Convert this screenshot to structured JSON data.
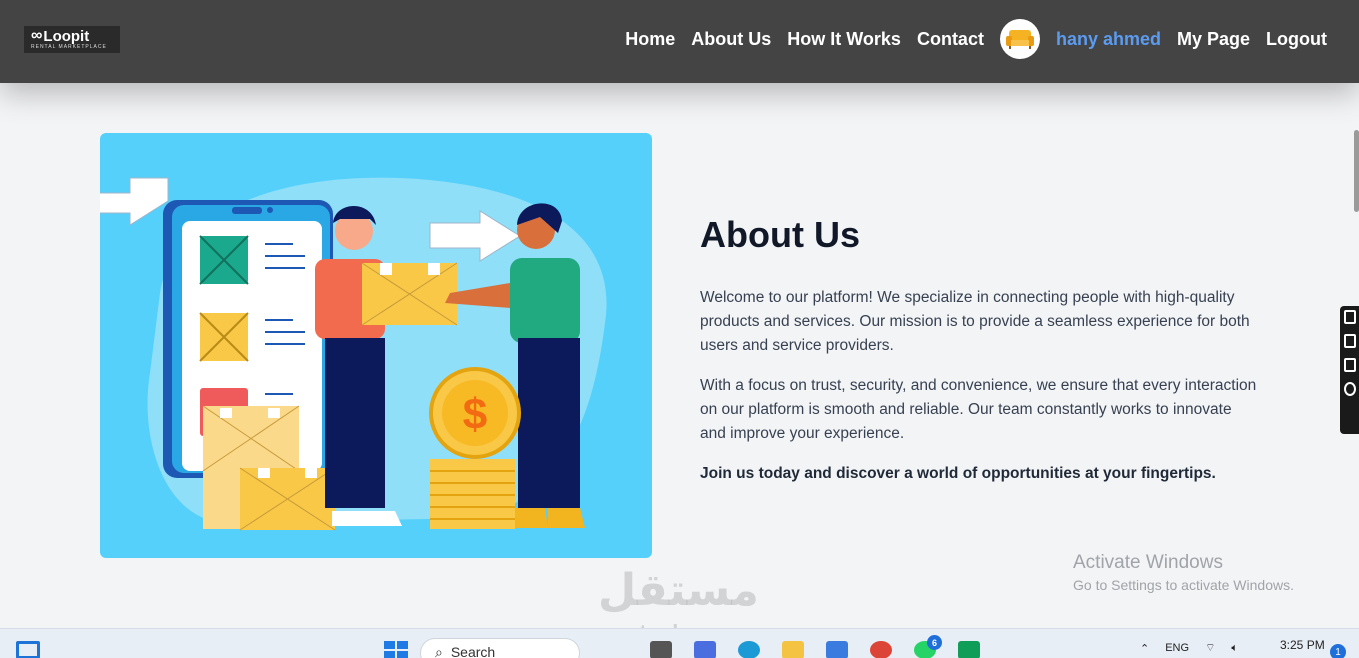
{
  "logo": {
    "name": "Loopit",
    "tagline": "RENTAL MARKETPLACE"
  },
  "nav": {
    "items": [
      "Home",
      "About Us",
      "How It Works",
      "Contact"
    ],
    "user_name": "hany ahmed",
    "my_page": "My Page",
    "logout": "Logout"
  },
  "about": {
    "title": "About Us",
    "p1": "Welcome to our platform! We specialize in connecting people with high-quality products and services. Our mission is to provide a seamless experience for both users and service providers.",
    "p2": "With a focus on trust, security, and convenience, we ensure that every interaction on our platform is smooth and reliable. Our team constantly works to innovate and improve your experience.",
    "p3": "Join us today and discover a world of opportunities at your fingertips."
  },
  "watermark": {
    "activate_title": "Activate Windows",
    "activate_sub": "Go to Settings to activate Windows.",
    "mostaql_ar": "مستقل",
    "mostaql_en": "mostaql.com"
  },
  "taskbar": {
    "search_placeholder": "Search",
    "whatsapp_badge": "6",
    "lang": "ENG",
    "time": "3:25 PM",
    "notifications": "1"
  },
  "colors": {
    "navbar": "#444444",
    "user_link": "#5b9bf0",
    "illustration_bg": "#55d0fb"
  }
}
